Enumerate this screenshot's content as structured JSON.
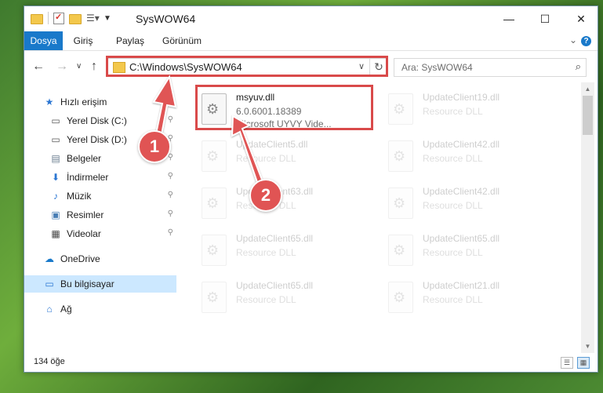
{
  "window": {
    "title": "SysWOW64",
    "controls": {
      "minimize": "—",
      "maximize": "☐",
      "close": "✕"
    }
  },
  "ribbon": {
    "tabs": [
      "Dosya",
      "Giriş",
      "Paylaş",
      "Görünüm"
    ],
    "expand_icon": "chevron-down-icon",
    "help": "?"
  },
  "navigation": {
    "back": "←",
    "forward": "→",
    "recent": "∨",
    "up": "↑",
    "address": "C:\\Windows\\SysWOW64",
    "refresh": "↻",
    "search_placeholder": "Ara: SysWOW64",
    "search_icon": "⌕"
  },
  "sidebar": {
    "items": [
      {
        "label": "Hızlı erişim",
        "icon": "star-icon",
        "glyph": "★",
        "color": "#2b76d2",
        "pinned": false
      },
      {
        "label": "Yerel Disk (C:)",
        "icon": "drive-icon",
        "glyph": "▭",
        "color": "#555555",
        "pinned": true
      },
      {
        "label": "Yerel Disk (D:)",
        "icon": "drive-icon",
        "glyph": "▭",
        "color": "#555555",
        "pinned": true
      },
      {
        "label": "Belgeler",
        "icon": "documents-icon",
        "glyph": "▤",
        "color": "#6a7d8f",
        "pinned": true
      },
      {
        "label": "İndirmeler",
        "icon": "download-icon",
        "glyph": "⬇",
        "color": "#2b76d2",
        "pinned": true
      },
      {
        "label": "Müzik",
        "icon": "music-icon",
        "glyph": "♪",
        "color": "#2b76d2",
        "pinned": true
      },
      {
        "label": "Resimler",
        "icon": "pictures-icon",
        "glyph": "▣",
        "color": "#4a7fb5",
        "pinned": true
      },
      {
        "label": "Videolar",
        "icon": "videos-icon",
        "glyph": "▦",
        "color": "#444444",
        "pinned": true
      },
      {
        "label": "OneDrive",
        "icon": "cloud-icon",
        "glyph": "☁",
        "color": "#1979ca",
        "pinned": false
      },
      {
        "label": "Bu bilgisayar",
        "icon": "computer-icon",
        "glyph": "▭",
        "color": "#2b76d2",
        "pinned": false,
        "selected": true
      },
      {
        "label": "Ağ",
        "icon": "network-icon",
        "glyph": "⌂",
        "color": "#2b76d2",
        "pinned": false
      }
    ],
    "pin_glyph": "📌"
  },
  "files": [
    {
      "name": "msyuv.dll",
      "line2": "6.0.6001.18389",
      "line3": "Microsoft UYVY Vide...",
      "highlighted": true
    },
    {
      "name": "UpdateClient19.dll",
      "line2": "Resource DLL",
      "highlighted": false
    },
    {
      "name": "UpdateClient5.dll",
      "line2": "Resource DLL",
      "highlighted": false
    },
    {
      "name": "UpdateClient42.dll",
      "line2": "Resource DLL",
      "highlighted": false
    },
    {
      "name": "UpdateClient63.dll",
      "line2": "Resource DLL",
      "highlighted": false
    },
    {
      "name": "UpdateClient42.dll",
      "line2": "Resource DLL",
      "highlighted": false
    },
    {
      "name": "UpdateClient65.dll",
      "line2": "Resource DLL",
      "highlighted": false
    },
    {
      "name": "UpdateClient65.dll",
      "line2": "Resource DLL",
      "highlighted": false
    },
    {
      "name": "UpdateClient65.dll",
      "line2": "Resource DLL",
      "highlighted": false
    },
    {
      "name": "UpdateClient21.dll",
      "line2": "Resource DLL",
      "highlighted": false
    }
  ],
  "status": {
    "item_count": "134 öğe"
  },
  "annotations": {
    "step1": "1",
    "step2": "2",
    "color": "#e05454"
  }
}
